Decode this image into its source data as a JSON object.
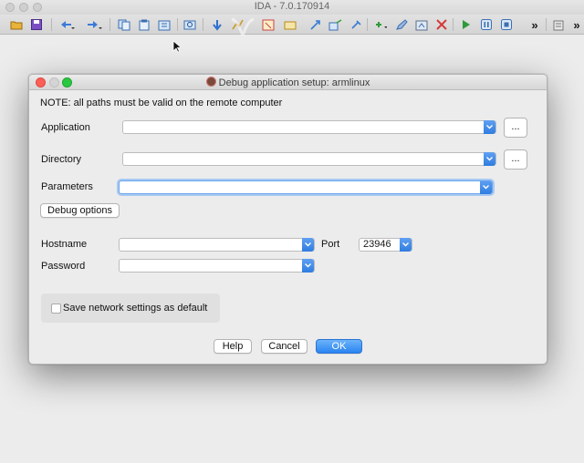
{
  "main_window": {
    "title": "IDA - 7.0.170914",
    "toolbar_icons": [
      "open-icon",
      "save-icon",
      "back-icon",
      "forward-icon",
      "copy-icon",
      "paste-icon",
      "cut-icon",
      "find-icon",
      "jump-icon",
      "graph-icon",
      "breakpoint-icon",
      "trace-icon",
      "step-icon",
      "add-icon",
      "edit-icon",
      "watch-icon",
      "remove-icon",
      "run-icon",
      "pause-icon",
      "stop-icon",
      "more-icon",
      "settings-icon",
      "tools-icon"
    ]
  },
  "dialog": {
    "title": "Debug application setup: armlinux",
    "note": "NOTE: all paths must be valid on the remote computer",
    "application_label": "Application",
    "application_value": "",
    "directory_label": "Directory",
    "directory_value": "",
    "parameters_label": "Parameters",
    "parameters_value": "",
    "browse_label": "...",
    "debug_options_label": "Debug options",
    "hostname_label": "Hostname",
    "hostname_value": "",
    "port_label": "Port",
    "port_value": "23946",
    "password_label": "Password",
    "password_value": "",
    "save_network_label": "Save network settings as default",
    "save_network_checked": false,
    "help_label": "Help",
    "cancel_label": "Cancel",
    "ok_label": "OK"
  },
  "colors": {
    "accent": "#2f7de0",
    "focus_ring": "#a8c9f2",
    "window_bg": "#ececec"
  }
}
